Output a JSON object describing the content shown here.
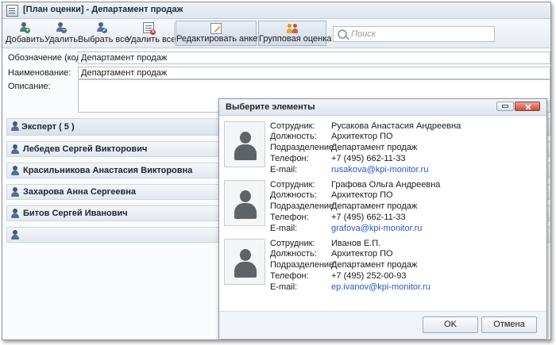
{
  "window": {
    "title": "[План оценки] - Департамент продаж"
  },
  "toolbar": {
    "add_label": "Добавить",
    "delete_label": "Удалить",
    "select_all_label": "Выбрать все",
    "delete_all_label": "Удалить все",
    "edit_form_label": "Редактировать анкету",
    "group_eval_label": "Групповая оценка",
    "search_placeholder": "Поиск"
  },
  "form": {
    "code_label": "Обозначение (код):",
    "code_value": "Департамент продаж",
    "name_label": "Наименование:",
    "name_value": "Департамент продаж",
    "description_label": "Описание:",
    "description_value": ""
  },
  "groups": {
    "experts": "Эксперт ( 5 )",
    "items": [
      "Лебедев Сергей Викторович",
      "Красильникова Анастасия Викторовна",
      "Захарова Анна Сергеевна",
      "Битов Сергей Иванович",
      ""
    ]
  },
  "dialog": {
    "title": "Выберите элементы",
    "labels": {
      "employee": "Сотрудник:",
      "position": "Должность:",
      "department": "Подразделение:",
      "phone": "Телефон:",
      "email": "E-mail:"
    },
    "employees": [
      {
        "name": "Русакова Анастасия Андреевна",
        "position": "Архитектор ПО",
        "department": "Департамент продаж",
        "phone": "+7 (495) 662-11-33",
        "email": "rusakova@kpi-monitor.ru"
      },
      {
        "name": "Графова Ольга Андреевна",
        "position": "Архитектор ПО",
        "department": "Департамент продаж",
        "phone": "+7 (495) 662-11-33",
        "email": "grafova@kpi-monitor.ru"
      },
      {
        "name": "Иванов Е.П.",
        "position": "Архитектор ПО",
        "department": "Департамент продаж",
        "phone": "+7 (495) 252-00-93",
        "email": "ep.ivanov@kpi-monitor.ru"
      }
    ],
    "ok_label": "OK",
    "cancel_label": "Отмена"
  },
  "colors": {
    "link": "#2a56c6",
    "close_button": "#cf4b3a",
    "toolbar_bg": "#e6ebf2"
  }
}
